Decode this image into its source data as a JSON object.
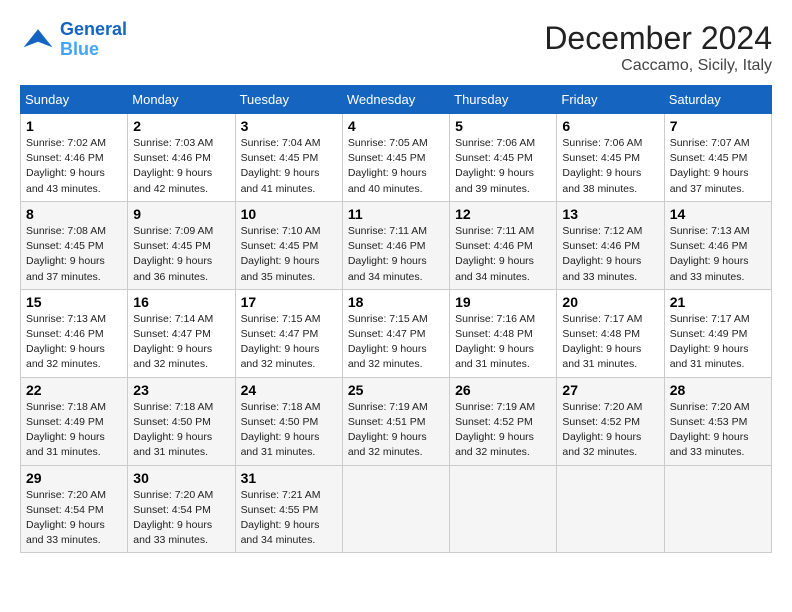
{
  "header": {
    "logo_line1": "General",
    "logo_line2": "Blue",
    "month": "December 2024",
    "location": "Caccamo, Sicily, Italy"
  },
  "weekdays": [
    "Sunday",
    "Monday",
    "Tuesday",
    "Wednesday",
    "Thursday",
    "Friday",
    "Saturday"
  ],
  "weeks": [
    [
      {
        "day": "1",
        "sunrise": "Sunrise: 7:02 AM",
        "sunset": "Sunset: 4:46 PM",
        "daylight": "Daylight: 9 hours and 43 minutes."
      },
      {
        "day": "2",
        "sunrise": "Sunrise: 7:03 AM",
        "sunset": "Sunset: 4:46 PM",
        "daylight": "Daylight: 9 hours and 42 minutes."
      },
      {
        "day": "3",
        "sunrise": "Sunrise: 7:04 AM",
        "sunset": "Sunset: 4:45 PM",
        "daylight": "Daylight: 9 hours and 41 minutes."
      },
      {
        "day": "4",
        "sunrise": "Sunrise: 7:05 AM",
        "sunset": "Sunset: 4:45 PM",
        "daylight": "Daylight: 9 hours and 40 minutes."
      },
      {
        "day": "5",
        "sunrise": "Sunrise: 7:06 AM",
        "sunset": "Sunset: 4:45 PM",
        "daylight": "Daylight: 9 hours and 39 minutes."
      },
      {
        "day": "6",
        "sunrise": "Sunrise: 7:06 AM",
        "sunset": "Sunset: 4:45 PM",
        "daylight": "Daylight: 9 hours and 38 minutes."
      },
      {
        "day": "7",
        "sunrise": "Sunrise: 7:07 AM",
        "sunset": "Sunset: 4:45 PM",
        "daylight": "Daylight: 9 hours and 37 minutes."
      }
    ],
    [
      {
        "day": "8",
        "sunrise": "Sunrise: 7:08 AM",
        "sunset": "Sunset: 4:45 PM",
        "daylight": "Daylight: 9 hours and 37 minutes."
      },
      {
        "day": "9",
        "sunrise": "Sunrise: 7:09 AM",
        "sunset": "Sunset: 4:45 PM",
        "daylight": "Daylight: 9 hours and 36 minutes."
      },
      {
        "day": "10",
        "sunrise": "Sunrise: 7:10 AM",
        "sunset": "Sunset: 4:45 PM",
        "daylight": "Daylight: 9 hours and 35 minutes."
      },
      {
        "day": "11",
        "sunrise": "Sunrise: 7:11 AM",
        "sunset": "Sunset: 4:46 PM",
        "daylight": "Daylight: 9 hours and 34 minutes."
      },
      {
        "day": "12",
        "sunrise": "Sunrise: 7:11 AM",
        "sunset": "Sunset: 4:46 PM",
        "daylight": "Daylight: 9 hours and 34 minutes."
      },
      {
        "day": "13",
        "sunrise": "Sunrise: 7:12 AM",
        "sunset": "Sunset: 4:46 PM",
        "daylight": "Daylight: 9 hours and 33 minutes."
      },
      {
        "day": "14",
        "sunrise": "Sunrise: 7:13 AM",
        "sunset": "Sunset: 4:46 PM",
        "daylight": "Daylight: 9 hours and 33 minutes."
      }
    ],
    [
      {
        "day": "15",
        "sunrise": "Sunrise: 7:13 AM",
        "sunset": "Sunset: 4:46 PM",
        "daylight": "Daylight: 9 hours and 32 minutes."
      },
      {
        "day": "16",
        "sunrise": "Sunrise: 7:14 AM",
        "sunset": "Sunset: 4:47 PM",
        "daylight": "Daylight: 9 hours and 32 minutes."
      },
      {
        "day": "17",
        "sunrise": "Sunrise: 7:15 AM",
        "sunset": "Sunset: 4:47 PM",
        "daylight": "Daylight: 9 hours and 32 minutes."
      },
      {
        "day": "18",
        "sunrise": "Sunrise: 7:15 AM",
        "sunset": "Sunset: 4:47 PM",
        "daylight": "Daylight: 9 hours and 32 minutes."
      },
      {
        "day": "19",
        "sunrise": "Sunrise: 7:16 AM",
        "sunset": "Sunset: 4:48 PM",
        "daylight": "Daylight: 9 hours and 31 minutes."
      },
      {
        "day": "20",
        "sunrise": "Sunrise: 7:17 AM",
        "sunset": "Sunset: 4:48 PM",
        "daylight": "Daylight: 9 hours and 31 minutes."
      },
      {
        "day": "21",
        "sunrise": "Sunrise: 7:17 AM",
        "sunset": "Sunset: 4:49 PM",
        "daylight": "Daylight: 9 hours and 31 minutes."
      }
    ],
    [
      {
        "day": "22",
        "sunrise": "Sunrise: 7:18 AM",
        "sunset": "Sunset: 4:49 PM",
        "daylight": "Daylight: 9 hours and 31 minutes."
      },
      {
        "day": "23",
        "sunrise": "Sunrise: 7:18 AM",
        "sunset": "Sunset: 4:50 PM",
        "daylight": "Daylight: 9 hours and 31 minutes."
      },
      {
        "day": "24",
        "sunrise": "Sunrise: 7:18 AM",
        "sunset": "Sunset: 4:50 PM",
        "daylight": "Daylight: 9 hours and 31 minutes."
      },
      {
        "day": "25",
        "sunrise": "Sunrise: 7:19 AM",
        "sunset": "Sunset: 4:51 PM",
        "daylight": "Daylight: 9 hours and 32 minutes."
      },
      {
        "day": "26",
        "sunrise": "Sunrise: 7:19 AM",
        "sunset": "Sunset: 4:52 PM",
        "daylight": "Daylight: 9 hours and 32 minutes."
      },
      {
        "day": "27",
        "sunrise": "Sunrise: 7:20 AM",
        "sunset": "Sunset: 4:52 PM",
        "daylight": "Daylight: 9 hours and 32 minutes."
      },
      {
        "day": "28",
        "sunrise": "Sunrise: 7:20 AM",
        "sunset": "Sunset: 4:53 PM",
        "daylight": "Daylight: 9 hours and 33 minutes."
      }
    ],
    [
      {
        "day": "29",
        "sunrise": "Sunrise: 7:20 AM",
        "sunset": "Sunset: 4:54 PM",
        "daylight": "Daylight: 9 hours and 33 minutes."
      },
      {
        "day": "30",
        "sunrise": "Sunrise: 7:20 AM",
        "sunset": "Sunset: 4:54 PM",
        "daylight": "Daylight: 9 hours and 33 minutes."
      },
      {
        "day": "31",
        "sunrise": "Sunrise: 7:21 AM",
        "sunset": "Sunset: 4:55 PM",
        "daylight": "Daylight: 9 hours and 34 minutes."
      },
      null,
      null,
      null,
      null
    ]
  ]
}
